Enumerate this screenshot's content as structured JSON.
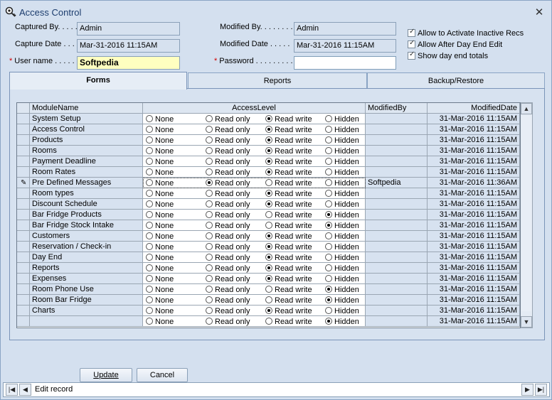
{
  "window": {
    "title": "Access Control"
  },
  "header": {
    "captured_by": {
      "label": "Captured By. . . . .",
      "value": "Admin"
    },
    "capture_date": {
      "label": "Capture Date  . . .",
      "value": "Mar-31-2016 11:15AM"
    },
    "user_name": {
      "label": "User name . . . . . .",
      "value": "Softpedia"
    },
    "modified_by": {
      "label": "Modified By. . . . . . . .",
      "value": "Admin"
    },
    "modified_date": {
      "label": "Modified Date  . . . . .",
      "value": "Mar-31-2016 11:15AM"
    },
    "password": {
      "label": "Password . . . . . . . . .",
      "value": ""
    },
    "required_mark": "*"
  },
  "options": [
    {
      "label": "Allow to Activate Inactive Recs",
      "checked": true
    },
    {
      "label": "Allow After Day End Edit",
      "checked": true
    },
    {
      "label": "Show day end totals",
      "checked": true
    }
  ],
  "tabs": [
    {
      "label": "Forms",
      "active": true
    },
    {
      "label": "Reports",
      "active": false
    },
    {
      "label": "Backup/Restore",
      "active": false
    }
  ],
  "grid": {
    "columns": [
      "ModuleName",
      "AccessLevel",
      "ModifiedBy",
      "ModifiedDate"
    ],
    "access_options": [
      "None",
      "Read only",
      "Read write",
      "Hidden"
    ],
    "rows": [
      {
        "module": "System Setup",
        "access": "Read write",
        "modified_by": "",
        "modified_date": "31-Mar-2016 11:15AM"
      },
      {
        "module": "Access Control",
        "access": "Read write",
        "modified_by": "",
        "modified_date": "31-Mar-2016 11:15AM"
      },
      {
        "module": "Products",
        "access": "Read write",
        "modified_by": "",
        "modified_date": "31-Mar-2016 11:15AM"
      },
      {
        "module": "Rooms",
        "access": "Read write",
        "modified_by": "",
        "modified_date": "31-Mar-2016 11:15AM"
      },
      {
        "module": "Payment Deadline",
        "access": "Read write",
        "modified_by": "",
        "modified_date": "31-Mar-2016 11:15AM"
      },
      {
        "module": "Room Rates",
        "access": "Read write",
        "modified_by": "",
        "modified_date": "31-Mar-2016 11:15AM"
      },
      {
        "module": "Pre Defined Messages",
        "access": "Read only",
        "modified_by": "Softpedia",
        "modified_date": "31-Mar-2016 11:36AM",
        "editing": true
      },
      {
        "module": "Room types",
        "access": "Read write",
        "modified_by": "",
        "modified_date": "31-Mar-2016 11:15AM"
      },
      {
        "module": "Discount Schedule",
        "access": "Read write",
        "modified_by": "",
        "modified_date": "31-Mar-2016 11:15AM"
      },
      {
        "module": "Bar Fridge Products",
        "access": "Hidden",
        "modified_by": "",
        "modified_date": "31-Mar-2016 11:15AM"
      },
      {
        "module": "Bar Fridge Stock Intake",
        "access": "Hidden",
        "modified_by": "",
        "modified_date": "31-Mar-2016 11:15AM"
      },
      {
        "module": "Customers",
        "access": "Read write",
        "modified_by": "",
        "modified_date": "31-Mar-2016 11:15AM"
      },
      {
        "module": "Reservation / Check-in",
        "access": "Read write",
        "modified_by": "",
        "modified_date": "31-Mar-2016 11:15AM"
      },
      {
        "module": "Day End",
        "access": "Read write",
        "modified_by": "",
        "modified_date": "31-Mar-2016 11:15AM"
      },
      {
        "module": "Reports",
        "access": "Read write",
        "modified_by": "",
        "modified_date": "31-Mar-2016 11:15AM"
      },
      {
        "module": "Expenses",
        "access": "Read write",
        "modified_by": "",
        "modified_date": "31-Mar-2016 11:15AM"
      },
      {
        "module": "Room Phone Use",
        "access": "Hidden",
        "modified_by": "",
        "modified_date": "31-Mar-2016 11:15AM"
      },
      {
        "module": "Room Bar Fridge",
        "access": "Hidden",
        "modified_by": "",
        "modified_date": "31-Mar-2016 11:15AM"
      },
      {
        "module": "Charts",
        "access": "Read write",
        "modified_by": "",
        "modified_date": "31-Mar-2016 11:15AM"
      },
      {
        "module": "",
        "access": "Hidden",
        "modified_by": "",
        "modified_date": "31-Mar-2016 11:15AM"
      }
    ]
  },
  "buttons": {
    "update": "Update",
    "cancel": "Cancel"
  },
  "navigator": {
    "status": "Edit record"
  }
}
